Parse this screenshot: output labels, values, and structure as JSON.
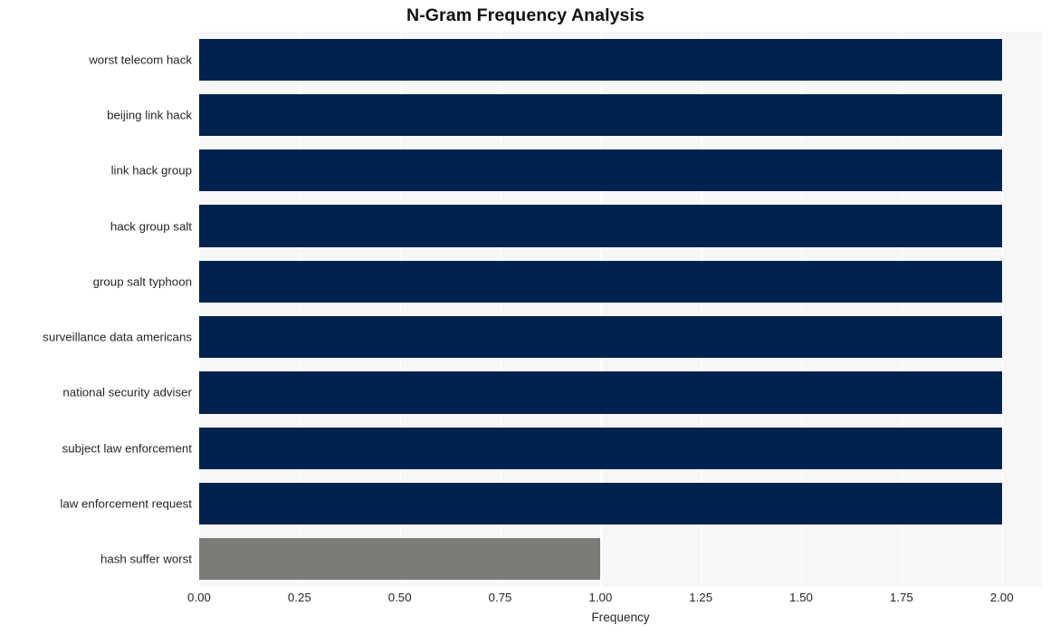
{
  "chart_data": {
    "type": "bar",
    "orientation": "horizontal",
    "title": "N-Gram Frequency Analysis",
    "xlabel": "Frequency",
    "ylabel": "",
    "categories": [
      "worst telecom hack",
      "beijing link hack",
      "link hack group",
      "hack group salt",
      "group salt typhoon",
      "surveillance data americans",
      "national security adviser",
      "subject law enforcement",
      "law enforcement request",
      "hash suffer worst"
    ],
    "values": [
      2,
      2,
      2,
      2,
      2,
      2,
      2,
      2,
      2,
      1
    ],
    "bar_colors": [
      "#00224e",
      "#00224e",
      "#00224e",
      "#00224e",
      "#00224e",
      "#00224e",
      "#00224e",
      "#00224e",
      "#00224e",
      "#7c7b78"
    ],
    "xlim": [
      0,
      2.1
    ],
    "xticks": [
      0,
      0.25,
      0.5,
      0.75,
      1.0,
      1.25,
      1.5,
      1.75,
      2.0
    ],
    "xtick_labels": [
      "0.00",
      "0.25",
      "0.50",
      "0.75",
      "1.00",
      "1.25",
      "1.50",
      "1.75",
      "2.00"
    ],
    "grid": true,
    "grid_axis": "x",
    "grid_color": "#ffffff",
    "plot_background": "#f7f7f8",
    "figure_background": "#ffffff",
    "legend": null
  }
}
